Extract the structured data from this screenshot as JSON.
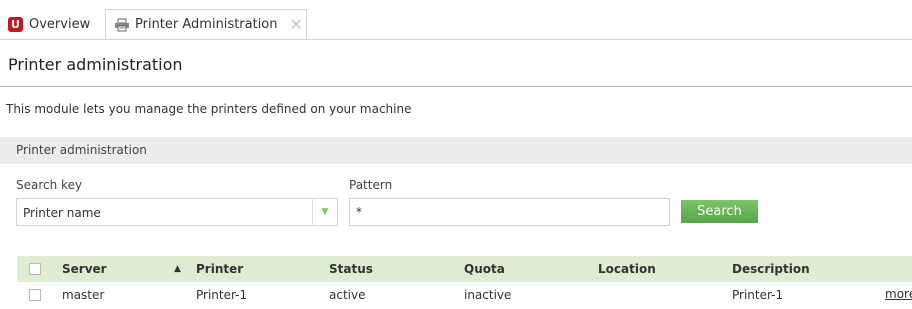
{
  "tabs": {
    "overview_label": "Overview",
    "active_label": "Printer Administration",
    "close_glyph": "✕"
  },
  "page": {
    "title": "Printer administration",
    "intro": "This module lets you manage the printers defined on your machine"
  },
  "panel": {
    "heading": "Printer administration",
    "search_key_label": "Search key",
    "search_key_value": "Printer name",
    "pattern_label": "Pattern",
    "pattern_value": "*",
    "search_button": "Search"
  },
  "grid": {
    "columns": [
      "Server",
      "Printer",
      "Status",
      "Quota",
      "Location",
      "Description"
    ],
    "rows": [
      {
        "server": "master",
        "printer": "Printer-1",
        "status": "active",
        "quota": "inactive",
        "location": "",
        "description": "Printer-1",
        "more": "more"
      }
    ]
  },
  "colors": {
    "brand": "#c8171e",
    "accent_green": "#55a546",
    "header_green": "#deecd2"
  }
}
